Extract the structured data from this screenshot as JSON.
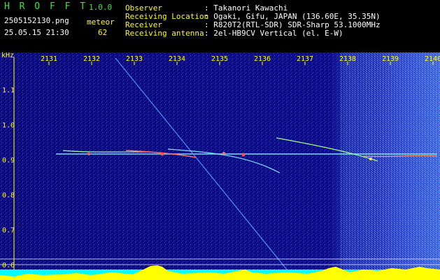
{
  "header": {
    "app_name": "H R O F F T",
    "version": "1.0.0",
    "filename": "2505152130.png",
    "datetime": "25.05.15 21:30",
    "meteor_label": "meteor",
    "meteor_count": "62",
    "info_labels": [
      "Observer",
      "Receiving Location",
      "Receiver",
      "Receiving antenna"
    ],
    "info_values": [
      ": Takanori Kawachi",
      ": Ogaki, Gifu, JAPAN (136.60E, 35.35N)",
      ": R820T2(RTL-SDR) SDR-Sharp 53.1000MHz",
      ": 2el-HB9CV Vertical (el. E-W)"
    ]
  },
  "spectrogram": {
    "y_unit": "kHz",
    "y_ticks": [
      "1.1",
      "1.0",
      "0.9",
      "0.8",
      "0.7",
      "0.6"
    ],
    "x_ticks": [
      "2131",
      "2132",
      "2133",
      "2134",
      "2135",
      "2136",
      "2137",
      "2138",
      "2139",
      "2140"
    ]
  }
}
